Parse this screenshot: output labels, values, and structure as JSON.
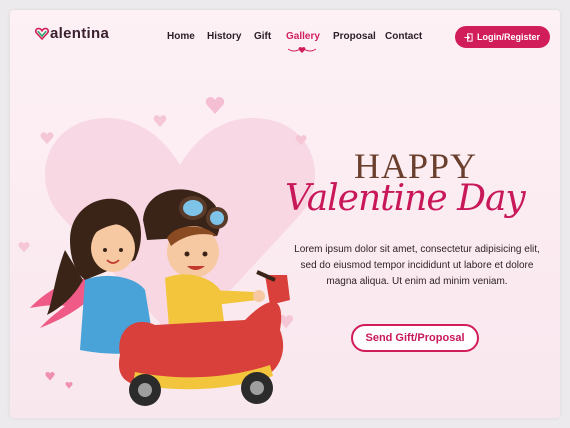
{
  "logo": {
    "text": "alentina",
    "icon": "heart-v-icon"
  },
  "nav": {
    "items": [
      {
        "label": "Home"
      },
      {
        "label": "History"
      },
      {
        "label": "Gift"
      },
      {
        "label": "Gallery",
        "active": true
      },
      {
        "label": "Proposal"
      },
      {
        "label": "Contact"
      }
    ]
  },
  "login": {
    "label": "Login/Register",
    "icon": "login-icon"
  },
  "hero": {
    "title_line1": "HAPPY",
    "title_line2": "Valentine Day",
    "body": "Lorem ipsum dolor sit amet, consectetur adipisicing elit, sed do eiusmod tempor incididunt ut labore et dolore magna aliqua. Ut enim ad minim veniam.",
    "cta": "Send Gift/Proposal"
  },
  "colors": {
    "accent": "#d21d5b",
    "title_brown": "#6b3f2d",
    "background": "#fdf1f5"
  }
}
